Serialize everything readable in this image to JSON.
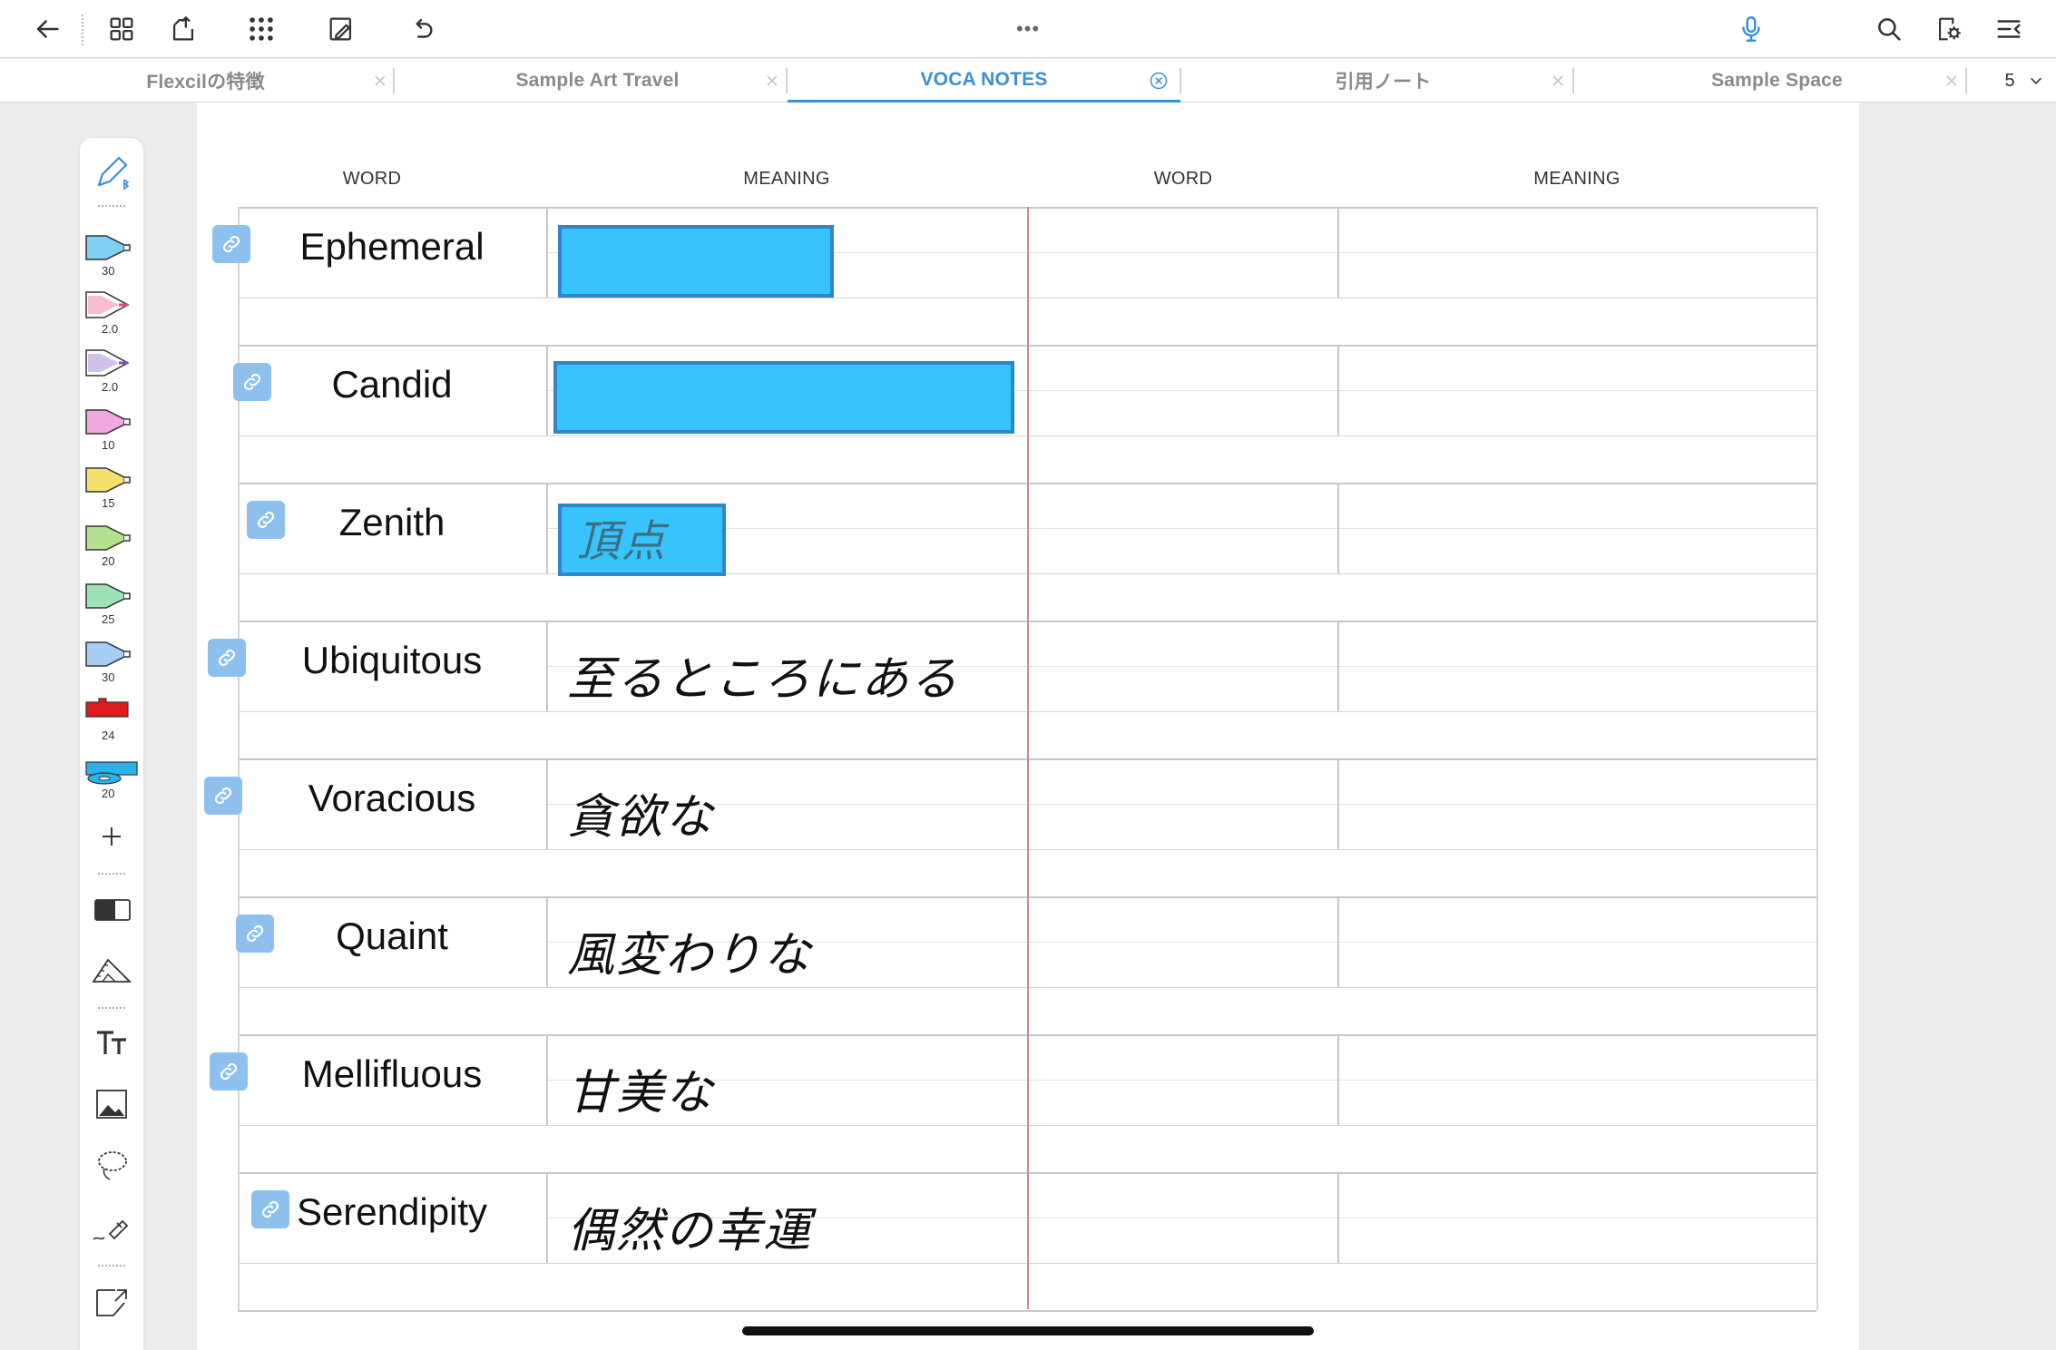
{
  "toolbar": {
    "more_dots": "•••",
    "accent": "#3a8fd6"
  },
  "tabs": [
    {
      "label": "Flexcilの特徴",
      "active": false
    },
    {
      "label": "Sample Art Travel",
      "active": false
    },
    {
      "label": "VOCA NOTES",
      "active": true
    },
    {
      "label": "引用ノート",
      "active": false
    },
    {
      "label": "Sample Space",
      "active": false
    }
  ],
  "tab_count": "5",
  "palette": {
    "tools": [
      {
        "icon": "pen-bluetooth-icon"
      },
      {
        "icon": "highlighter-icon",
        "color": "#7fd0f2",
        "size": "30"
      },
      {
        "icon": "pen-icon",
        "color": "#e9467f",
        "size": "2.0"
      },
      {
        "icon": "pen-icon",
        "color": "#7a4fc8",
        "size": "2.0"
      },
      {
        "icon": "highlighter-icon",
        "color": "#f1a7e0",
        "size": "10"
      },
      {
        "icon": "highlighter-icon",
        "color": "#f5e06a",
        "size": "15"
      },
      {
        "icon": "highlighter-icon",
        "color": "#b5e38d",
        "size": "20"
      },
      {
        "icon": "highlighter-icon",
        "color": "#9ee3b8",
        "size": "25"
      },
      {
        "icon": "highlighter-icon",
        "color": "#a6cdf4",
        "size": "30"
      },
      {
        "icon": "tape-icon",
        "color": "#e0191d",
        "size": "24"
      },
      {
        "icon": "tape-roll-icon",
        "color": "#2bb2e8",
        "size": "20"
      }
    ]
  },
  "table": {
    "headers": [
      "WORD",
      "MEANING",
      "WORD",
      "MEANING"
    ],
    "rows": [
      {
        "word": "Ephemeral",
        "meaning": "",
        "masked": true
      },
      {
        "word": "Candid",
        "meaning": "",
        "masked": true
      },
      {
        "word": "Zenith",
        "meaning": "頂点",
        "masked": true
      },
      {
        "word": "Ubiquitous",
        "meaning": "至るところにある",
        "masked": false
      },
      {
        "word": "Voracious",
        "meaning": "貪欲な",
        "masked": false
      },
      {
        "word": "Quaint",
        "meaning": "風変わりな",
        "masked": false
      },
      {
        "word": "Mellifluous",
        "meaning": "甘美な",
        "masked": false
      },
      {
        "word": "Serendipity",
        "meaning": "偶然の幸運",
        "masked": false
      }
    ],
    "mask_color": "#38c4fb"
  }
}
